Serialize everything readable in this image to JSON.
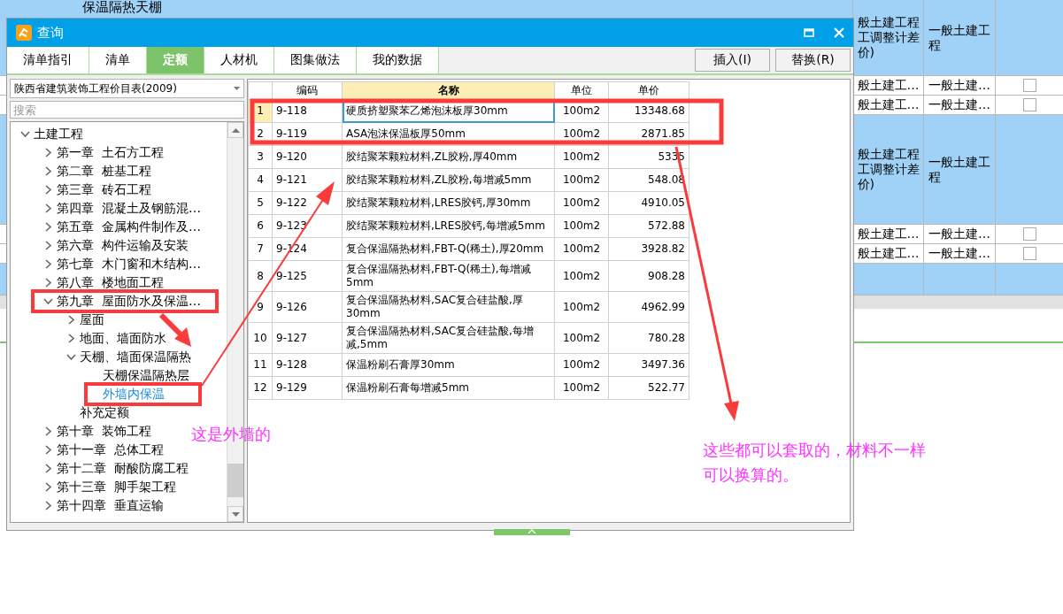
{
  "background": {
    "title_cell": "保温隔热天棚",
    "rows": [
      {
        "kind": "group",
        "col_a": "般土建工程工调整计差价)",
        "col_b": "一般土建工程"
      },
      {
        "kind": "item",
        "col_a": "般土建工…",
        "col_b": "一般土建…",
        "checked": false
      },
      {
        "kind": "item",
        "col_a": "般土建工…",
        "col_b": "一般土建…",
        "checked": false
      },
      {
        "kind": "group",
        "col_a": "般土建工程工调整计差价)",
        "col_b": "一般土建工程"
      },
      {
        "kind": "item",
        "col_a": "般土建工…",
        "col_b": "一般土建…",
        "checked": false
      },
      {
        "kind": "item",
        "col_a": "般土建工…",
        "col_b": "一般土建…",
        "checked": false
      },
      {
        "kind": "tail"
      }
    ]
  },
  "window": {
    "title": "查询"
  },
  "tabs": [
    {
      "label": "清单指引",
      "selected": false
    },
    {
      "label": "清单",
      "selected": false
    },
    {
      "label": "定额",
      "selected": true
    },
    {
      "label": "人材机",
      "selected": false
    },
    {
      "label": "图集做法",
      "selected": false
    },
    {
      "label": "我的数据",
      "selected": false
    }
  ],
  "buttons": [
    "插入(I)",
    "替换(R)"
  ],
  "catalog_select": {
    "value": "陕西省建筑装饰工程价目表(2009)"
  },
  "search": {
    "placeholder": "搜索"
  },
  "tree": [
    {
      "label": "土建工程",
      "kind": "folder",
      "expanded": true,
      "selected": false,
      "children": [
        {
          "label": "第一章  土石方工程",
          "kind": "folder",
          "expanded": false,
          "selected": false
        },
        {
          "label": "第二章  桩基工程",
          "kind": "folder",
          "expanded": false,
          "selected": false
        },
        {
          "label": "第三章  砖石工程",
          "kind": "folder",
          "expanded": false,
          "selected": false
        },
        {
          "label": "第四章  混凝土及钢筋混…",
          "kind": "folder",
          "expanded": false,
          "selected": false
        },
        {
          "label": "第五章  金属构件制作及…",
          "kind": "folder",
          "expanded": false,
          "selected": false
        },
        {
          "label": "第六章  构件运输及安装",
          "kind": "folder",
          "expanded": false,
          "selected": false
        },
        {
          "label": "第七章  木门窗和木结构…",
          "kind": "folder",
          "expanded": false,
          "selected": false
        },
        {
          "label": "第八章  楼地面工程",
          "kind": "folder",
          "expanded": false,
          "selected": false
        },
        {
          "label": "第九章  屋面防水及保温…",
          "kind": "folder",
          "expanded": true,
          "selected": false,
          "children": [
            {
              "label": "屋面",
              "kind": "folder",
              "expanded": false,
              "selected": false
            },
            {
              "label": "地面、墙面防水",
              "kind": "folder",
              "expanded": false,
              "selected": false
            },
            {
              "label": "天棚、墙面保温隔热",
              "kind": "folder",
              "expanded": true,
              "selected": false,
              "children": [
                {
                  "label": "天棚保温隔热层",
                  "kind": "leaf",
                  "selected": false
                },
                {
                  "label": "外墙内保温",
                  "kind": "leaf",
                  "selected": true
                }
              ]
            },
            {
              "label": "补充定额",
              "kind": "leaf",
              "selected": false
            }
          ]
        },
        {
          "label": "第十章  装饰工程",
          "kind": "folder",
          "expanded": false,
          "selected": false
        },
        {
          "label": "第十一章  总体工程",
          "kind": "folder",
          "expanded": false,
          "selected": false
        },
        {
          "label": "第十二章  耐酸防腐工程",
          "kind": "folder",
          "expanded": false,
          "selected": false
        },
        {
          "label": "第十三章  脚手架工程",
          "kind": "folder",
          "expanded": false,
          "selected": false
        },
        {
          "label": "第十四章  垂直运输",
          "kind": "folder",
          "expanded": false,
          "selected": false
        }
      ]
    }
  ],
  "table": {
    "columns": [
      "编码",
      "名称",
      "单位",
      "单价"
    ],
    "rows": [
      {
        "no": "1",
        "code": "9-118",
        "name": "硬质挤塑聚苯乙烯泡沫板厚30mm",
        "unit": "100m2",
        "price": "13348.68",
        "selected": true
      },
      {
        "no": "2",
        "code": "9-119",
        "name": "ASA泡沫保温板厚50mm",
        "unit": "100m2",
        "price": "2871.85",
        "selected": false
      },
      {
        "no": "3",
        "code": "9-120",
        "name": "胶结聚苯颗粒材料,ZL胶粉,厚40mm",
        "unit": "100m2",
        "price": "5335",
        "selected": false
      },
      {
        "no": "4",
        "code": "9-121",
        "name": "胶结聚苯颗粒材料,ZL胶粉,每增减5mm",
        "unit": "100m2",
        "price": "548.08",
        "selected": false
      },
      {
        "no": "5",
        "code": "9-122",
        "name": "胶结聚苯颗粒材料,LRES胶钙,厚30mm",
        "unit": "100m2",
        "price": "4910.05",
        "selected": false
      },
      {
        "no": "6",
        "code": "9-123",
        "name": "胶结聚苯颗粒材料,LRES胶钙,每增减5mm",
        "unit": "100m2",
        "price": "572.88",
        "selected": false
      },
      {
        "no": "7",
        "code": "9-124",
        "name": "复合保温隔热材料,FBT-Q(稀土),厚20mm",
        "unit": "100m2",
        "price": "3928.82",
        "selected": false
      },
      {
        "no": "8",
        "code": "9-125",
        "name": "复合保温隔热材料,FBT-Q(稀土),每增减5mm",
        "unit": "100m2",
        "price": "908.28",
        "selected": false
      },
      {
        "no": "9",
        "code": "9-126",
        "name": "复合保温隔热材料,SAC复合硅盐酸,厚30mm",
        "unit": "100m2",
        "price": "4962.99",
        "selected": false
      },
      {
        "no": "10",
        "code": "9-127",
        "name": "复合保温隔热材料,SAC复合硅盐酸,每增减,5mm",
        "unit": "100m2",
        "price": "780.28",
        "selected": false
      },
      {
        "no": "11",
        "code": "9-128",
        "name": "保温粉刷石膏厚30mm",
        "unit": "100m2",
        "price": "3497.36",
        "selected": false
      },
      {
        "no": "12",
        "code": "9-129",
        "name": "保温粉刷石膏每增减5mm",
        "unit": "100m2",
        "price": "522.77",
        "selected": false
      }
    ]
  },
  "annotations": [
    "这是外墙的",
    "这些都可以套取的，材料不一样",
    "可以换算的。"
  ]
}
